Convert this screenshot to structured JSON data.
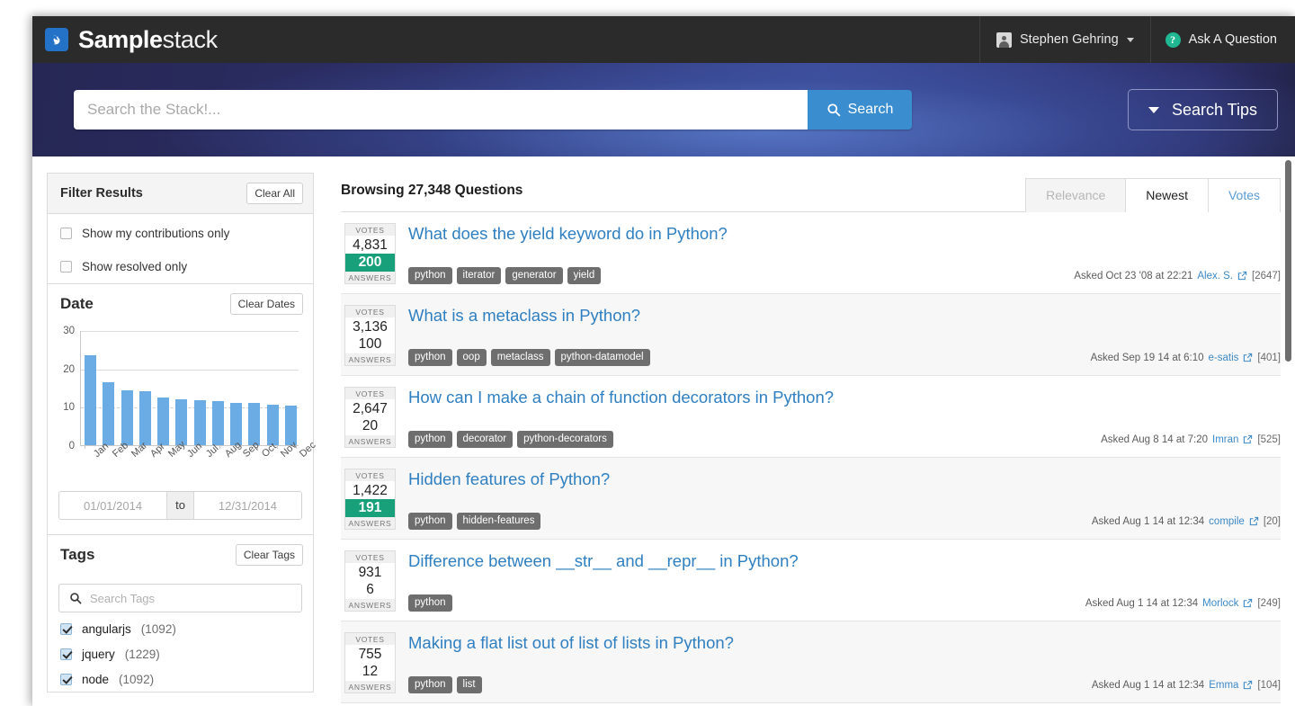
{
  "brand": {
    "bold": "Sample",
    "light": "stack",
    "logo_icon": "bird-logo-icon"
  },
  "topbar": {
    "user_name": "Stephen Gehring",
    "ask_label": "Ask A Question",
    "question_icon": "question-mark-icon",
    "avatar_icon": "user-avatar-icon",
    "caret_icon": "chevron-down-icon"
  },
  "search": {
    "placeholder": "Search the Stack!...",
    "value": "",
    "button_label": "Search",
    "search_icon": "magnifier-icon",
    "tips_label": "Search Tips",
    "tips_caret_icon": "chevron-down-icon"
  },
  "sidebar": {
    "filter": {
      "title": "Filter Results",
      "clear_label": "Clear All",
      "checkboxes": [
        {
          "label": "Show my contributions only",
          "checked": false
        },
        {
          "label": "Show resolved only",
          "checked": false
        }
      ]
    },
    "date": {
      "title": "Date",
      "clear_label": "Clear Dates",
      "from_placeholder": "01/01/2014",
      "from_value": "",
      "separator": "to",
      "to_placeholder": "12/31/2014",
      "to_value": ""
    },
    "tags": {
      "title": "Tags",
      "clear_label": "Clear Tags",
      "search_placeholder": "Search Tags",
      "search_value": "",
      "search_icon": "magnifier-icon",
      "items": [
        {
          "name": "angularjs",
          "count": "(1092)",
          "checked": true
        },
        {
          "name": "jquery",
          "count": "(1229)",
          "checked": true
        },
        {
          "name": "node",
          "count": "(1092)",
          "checked": true
        }
      ]
    }
  },
  "results": {
    "browsing_label": "Browsing 27,348 Questions",
    "sort_tabs": [
      {
        "label": "Relevance",
        "state": "disabled"
      },
      {
        "label": "Newest",
        "state": "active"
      },
      {
        "label": "Votes",
        "state": "link"
      }
    ],
    "vote_caption": "VOTES",
    "answer_caption": "ANSWERS",
    "questions": [
      {
        "title": "What does the yield keyword do in Python?",
        "votes": "4,831",
        "answers": "200",
        "accepted": true,
        "tags": [
          "python",
          "iterator",
          "generator",
          "yield"
        ],
        "asked": "Asked Oct 23 '08 at 22:21",
        "author": "Alex. S.",
        "reputation": "[2647]",
        "link_icon": "external-link-icon"
      },
      {
        "title": "What is a metaclass in Python?",
        "votes": "3,136",
        "answers": "100",
        "accepted": false,
        "tags": [
          "python",
          "oop",
          "metaclass",
          "python-datamodel"
        ],
        "asked": "Asked Sep 19 14 at 6:10",
        "author": "e-satis",
        "reputation": "[401]",
        "link_icon": "external-link-icon"
      },
      {
        "title": "How can I make a chain of function decorators in Python?",
        "votes": "2,647",
        "answers": "20",
        "accepted": false,
        "tags": [
          "python",
          "decorator",
          "python-decorators"
        ],
        "asked": "Asked Aug 8 14 at 7:20",
        "author": "Imran",
        "reputation": "[525]",
        "link_icon": "external-link-icon"
      },
      {
        "title": "Hidden features of Python?",
        "votes": "1,422",
        "answers": "191",
        "accepted": true,
        "tags": [
          "python",
          "hidden-features"
        ],
        "asked": "Asked Aug 1 14 at 12:34",
        "author": "compile",
        "reputation": "[20]",
        "link_icon": "external-link-icon"
      },
      {
        "title": "Difference between __str__ and __repr__ in Python?",
        "votes": "931",
        "answers": "6",
        "accepted": false,
        "tags": [
          "python"
        ],
        "asked": "Asked Aug 1 14 at 12:34",
        "author": "Morlock",
        "reputation": "[249]",
        "link_icon": "external-link-icon"
      },
      {
        "title": "Making a flat list out of list of lists in Python?",
        "votes": "755",
        "answers": "12",
        "accepted": false,
        "tags": [
          "python",
          "list"
        ],
        "asked": "Asked Aug 1 14 at 12:34",
        "author": "Emma",
        "reputation": "[104]",
        "link_icon": "external-link-icon"
      }
    ]
  },
  "colors": {
    "accent_blue": "#3a8dcf",
    "link_blue": "#2f7fc1",
    "accepted_green": "#17a07a",
    "nav_navy": "#2a2b66",
    "topbar_dark": "#2b2b2b",
    "bar_blue": "#6cace4",
    "tag_grey": "#6e6e6e"
  },
  "chart_data": {
    "type": "bar",
    "title": "Date",
    "categories": [
      "Jan",
      "Feb",
      "Mar",
      "Apr",
      "May",
      "Jun",
      "Jul",
      "Aug",
      "Sep",
      "Oct",
      "Nov",
      "Dec"
    ],
    "values": [
      23.5,
      16.3,
      14.2,
      14.0,
      12.4,
      11.9,
      11.7,
      11.5,
      11.1,
      11.1,
      10.5,
      10.2
    ],
    "xlabel": "",
    "ylabel": "",
    "ylim": [
      0,
      30
    ],
    "yticks": [
      0,
      10,
      20,
      30
    ],
    "grid": true,
    "legend": false,
    "bar_color": "#6cace4"
  }
}
